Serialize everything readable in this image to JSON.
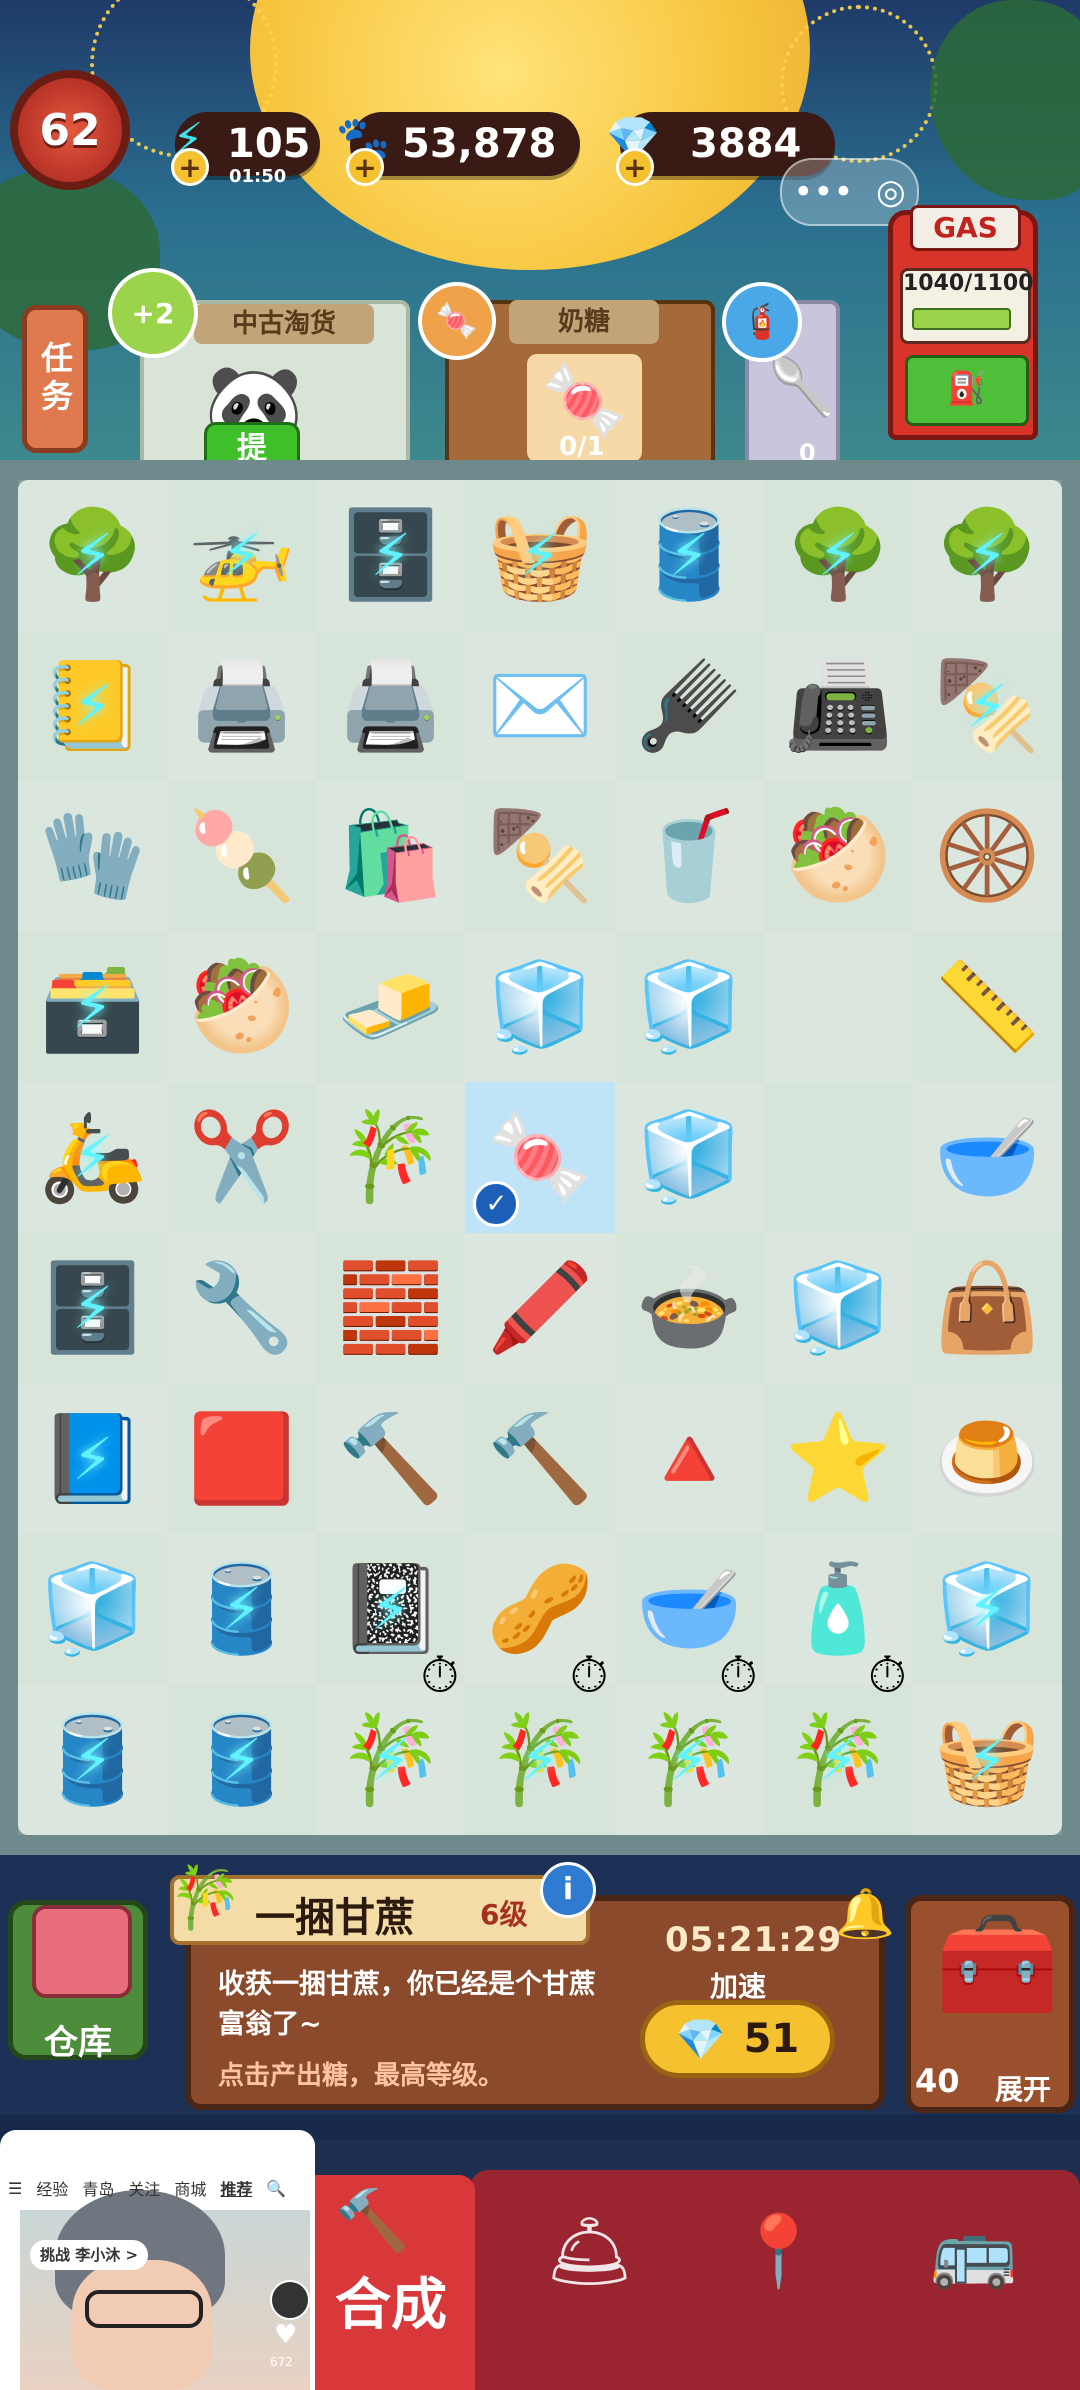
{
  "header": {
    "level": "62",
    "energy": "105",
    "energy_timer": "01:50",
    "coins": "53,878",
    "gems": "3884",
    "menu_dots": "•••",
    "menu_target": "◎"
  },
  "gas_pump": {
    "label": "GAS",
    "value": "1040/1100",
    "fill_fraction": 0.945
  },
  "side_tab": {
    "label": "任务"
  },
  "orders": [
    {
      "title": "中古淘货",
      "badge": "+2",
      "button": "提"
    },
    {
      "title": "奶糖",
      "progress": "0/1"
    },
    {
      "progress": "0"
    }
  ],
  "board": {
    "rows": [
      [
        {
          "icon": "🌳",
          "locked": true
        },
        {
          "icon": "🚁",
          "locked": true
        },
        {
          "icon": "🗄️",
          "locked": true
        },
        {
          "icon": "🧺",
          "locked": true
        },
        {
          "icon": "🛢️",
          "locked": true
        },
        {
          "icon": "🌳",
          "locked": true
        },
        {
          "icon": "🌳",
          "locked": true
        }
      ],
      [
        {
          "icon": "📒",
          "locked": true
        },
        {
          "icon": "🖨️",
          "locked": false
        },
        {
          "icon": "🖨️",
          "locked": false
        },
        {
          "icon": "✉️",
          "locked": false
        },
        {
          "icon": "🪮",
          "locked": false
        },
        {
          "icon": "📠",
          "locked": false
        },
        {
          "icon": "🍢",
          "locked": true
        }
      ],
      [
        {
          "icon": "🧤",
          "locked": false
        },
        {
          "icon": "🍡",
          "locked": false
        },
        {
          "icon": "🛍️",
          "locked": false
        },
        {
          "icon": "🍢",
          "locked": false
        },
        {
          "icon": "🥤",
          "locked": false
        },
        {
          "icon": "🥙",
          "locked": false
        },
        {
          "icon": "🛞",
          "locked": false
        }
      ],
      [
        {
          "icon": "🗃️",
          "locked": true
        },
        {
          "icon": "🥙",
          "locked": false
        },
        {
          "icon": "🧈",
          "locked": false
        },
        {
          "icon": "🧊",
          "locked": false
        },
        {
          "icon": "🧊",
          "locked": false
        },
        {
          "icon": "",
          "locked": false
        },
        {
          "icon": "📏",
          "locked": false
        }
      ],
      [
        {
          "icon": "🛵",
          "locked": true
        },
        {
          "icon": "✂️",
          "locked": false
        },
        {
          "icon": "🎋",
          "locked": false
        },
        {
          "icon": "🍬",
          "locked": false,
          "selected": true
        },
        {
          "icon": "🧊",
          "locked": false
        },
        {
          "icon": "",
          "locked": false
        },
        {
          "icon": "🥣",
          "locked": false
        }
      ],
      [
        {
          "icon": "🗄️",
          "locked": true
        },
        {
          "icon": "🔧",
          "locked": false
        },
        {
          "icon": "🧱",
          "locked": false
        },
        {
          "icon": "🖍️",
          "locked": false
        },
        {
          "icon": "🍲",
          "locked": false
        },
        {
          "icon": "🧊",
          "locked": false
        },
        {
          "icon": "👜",
          "locked": false
        }
      ],
      [
        {
          "icon": "📘",
          "locked": true
        },
        {
          "icon": "🟥",
          "locked": false
        },
        {
          "icon": "🔨",
          "locked": false
        },
        {
          "icon": "🔨",
          "locked": false
        },
        {
          "icon": "🔺",
          "locked": false
        },
        {
          "icon": "⭐",
          "locked": false
        },
        {
          "icon": "🍮",
          "locked": false
        }
      ],
      [
        {
          "icon": "🧊",
          "locked": false
        },
        {
          "icon": "🛢️",
          "locked": true
        },
        {
          "icon": "📓",
          "locked": true
        },
        {
          "icon": "🥜",
          "locked": false
        },
        {
          "icon": "🥣",
          "locked": false
        },
        {
          "icon": "🧴",
          "locked": false
        },
        {
          "icon": "🧊",
          "locked": true
        }
      ],
      [
        {
          "icon": "🛢️",
          "locked": true
        },
        {
          "icon": "🛢️",
          "locked": true
        },
        {
          "icon": "🎋",
          "locked": true,
          "timer": true
        },
        {
          "icon": "🎋",
          "locked": true,
          "timer": true
        },
        {
          "icon": "🎋",
          "locked": true,
          "timer": true
        },
        {
          "icon": "🎋",
          "locked": true,
          "timer": true
        },
        {
          "icon": "🧺",
          "locked": true
        }
      ]
    ]
  },
  "info_panel": {
    "title": "一捆甘蔗",
    "level": "6级",
    "badge": "i",
    "description": "收获一捆甘蔗，你已经是个甘蔗富翁了~",
    "hint": "点击产出糖，最高等级。",
    "timer": "05:21:29",
    "speed_label": "加速",
    "speed_cost": "51"
  },
  "warehouse": {
    "label": "仓库"
  },
  "chest": {
    "count": "40",
    "expand_label": "展开"
  },
  "bottom_nav": {
    "merge_label": "合成"
  },
  "video_overlay": {
    "tabs": [
      "经验",
      "青岛",
      "关注",
      "商城",
      "推荐"
    ],
    "challenge": "挑战 李小沐 >",
    "likes": "672"
  }
}
